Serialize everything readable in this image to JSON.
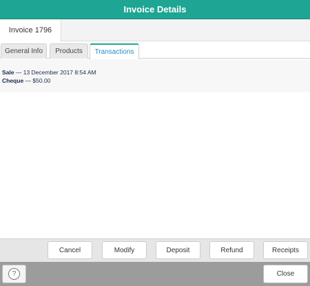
{
  "window": {
    "title": "Invoice Details"
  },
  "invoice": {
    "label": "Invoice 1796"
  },
  "tabs": [
    {
      "label": "General Info",
      "active": false
    },
    {
      "label": "Products",
      "active": false
    },
    {
      "label": "Transactions",
      "active": true
    }
  ],
  "transactions": {
    "line1": {
      "type": "Sale",
      "detail": " — 13 December 2017 8:54 AM"
    },
    "line2": {
      "method": "Cheque",
      "detail": " — $50.00"
    }
  },
  "actions": {
    "cancel": "Cancel",
    "modify": "Modify",
    "deposit": "Deposit",
    "refund": "Refund",
    "receipts": "Receipts"
  },
  "footer": {
    "help_icon": "?",
    "close": "Close"
  },
  "colors": {
    "titlebar": "#1ea593",
    "active_tab_text": "#1f8fc4",
    "footer": "#9c9c9c"
  }
}
